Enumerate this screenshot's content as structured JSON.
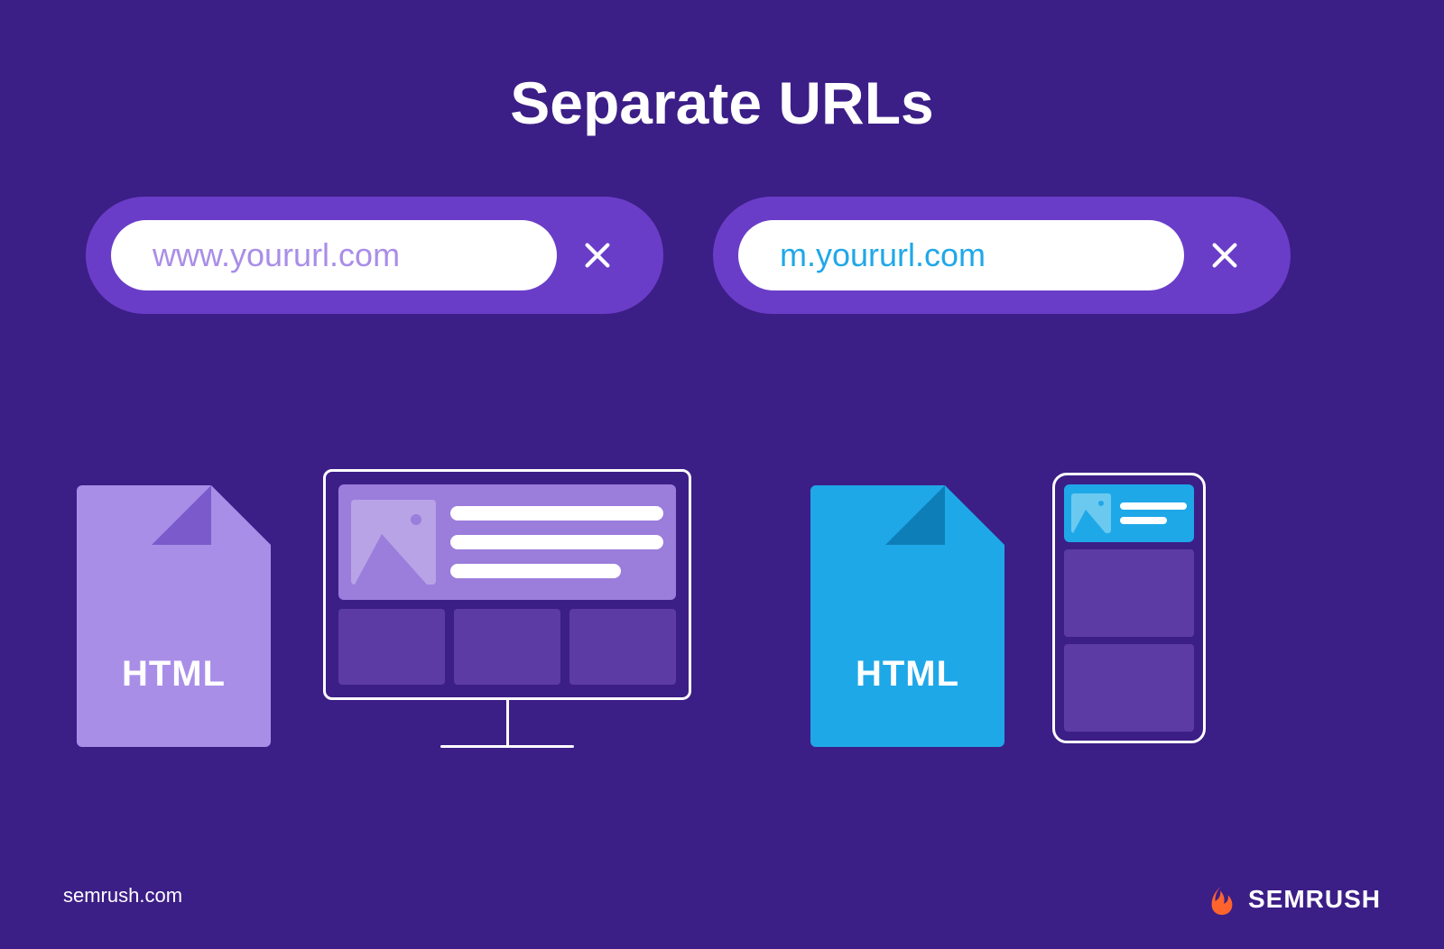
{
  "title": "Separate URLs",
  "urls": {
    "desktop": "www.yoururl.com",
    "mobile": "m.yoururl.com"
  },
  "file_label": "HTML",
  "footer": {
    "site": "semrush.com",
    "brand": "SEMRUSH"
  },
  "colors": {
    "background": "#3C1E87",
    "pill_bg": "#6A3DC8",
    "desktop_accent": "#A98EE8",
    "mobile_accent": "#1FA8E8",
    "brand_orange": "#FF642D"
  }
}
